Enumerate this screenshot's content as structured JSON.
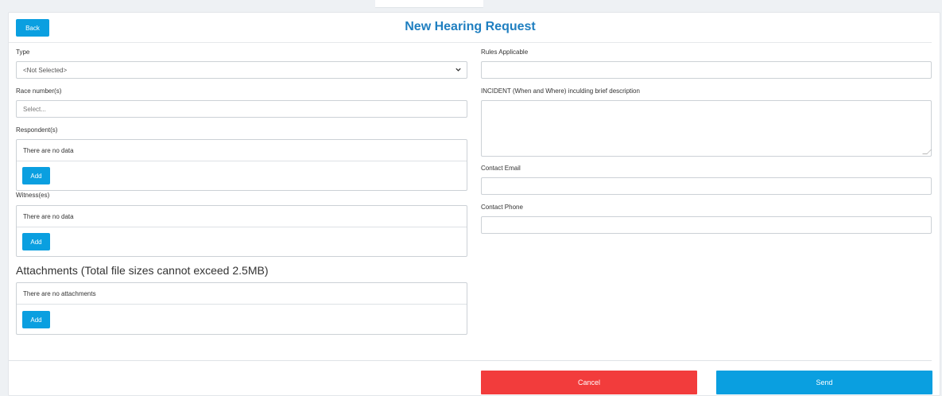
{
  "header": {
    "back_label": "Back",
    "title": "New Hearing Request"
  },
  "form_left": {
    "type_label": "Type",
    "type_value": "<Not Selected>",
    "race_label": "Race number(s)",
    "race_placeholder": "Select...",
    "respondents_label": "Respondent(s)",
    "respondents_empty": "There are no data",
    "respondents_add": "Add",
    "witnesses_label": "Witness(es)",
    "witnesses_empty": "There are no data",
    "witnesses_add": "Add",
    "attachments_title": "Attachments (Total file sizes cannot exceed 2.5MB)",
    "attachments_empty": "There are no attachments",
    "attachments_add": "Add"
  },
  "form_right": {
    "rules_label": "Rules Applicable",
    "rules_value": "",
    "incident_label": "INCIDENT (When and Where) inculding brief description",
    "incident_value": "",
    "email_label": "Contact Email",
    "email_value": "",
    "phone_label": "Contact Phone",
    "phone_value": ""
  },
  "footer": {
    "cancel_label": "Cancel",
    "send_label": "Send"
  },
  "colors": {
    "accent": "#0a9fe0",
    "title": "#1f7fc0",
    "danger": "#f23c3c"
  }
}
